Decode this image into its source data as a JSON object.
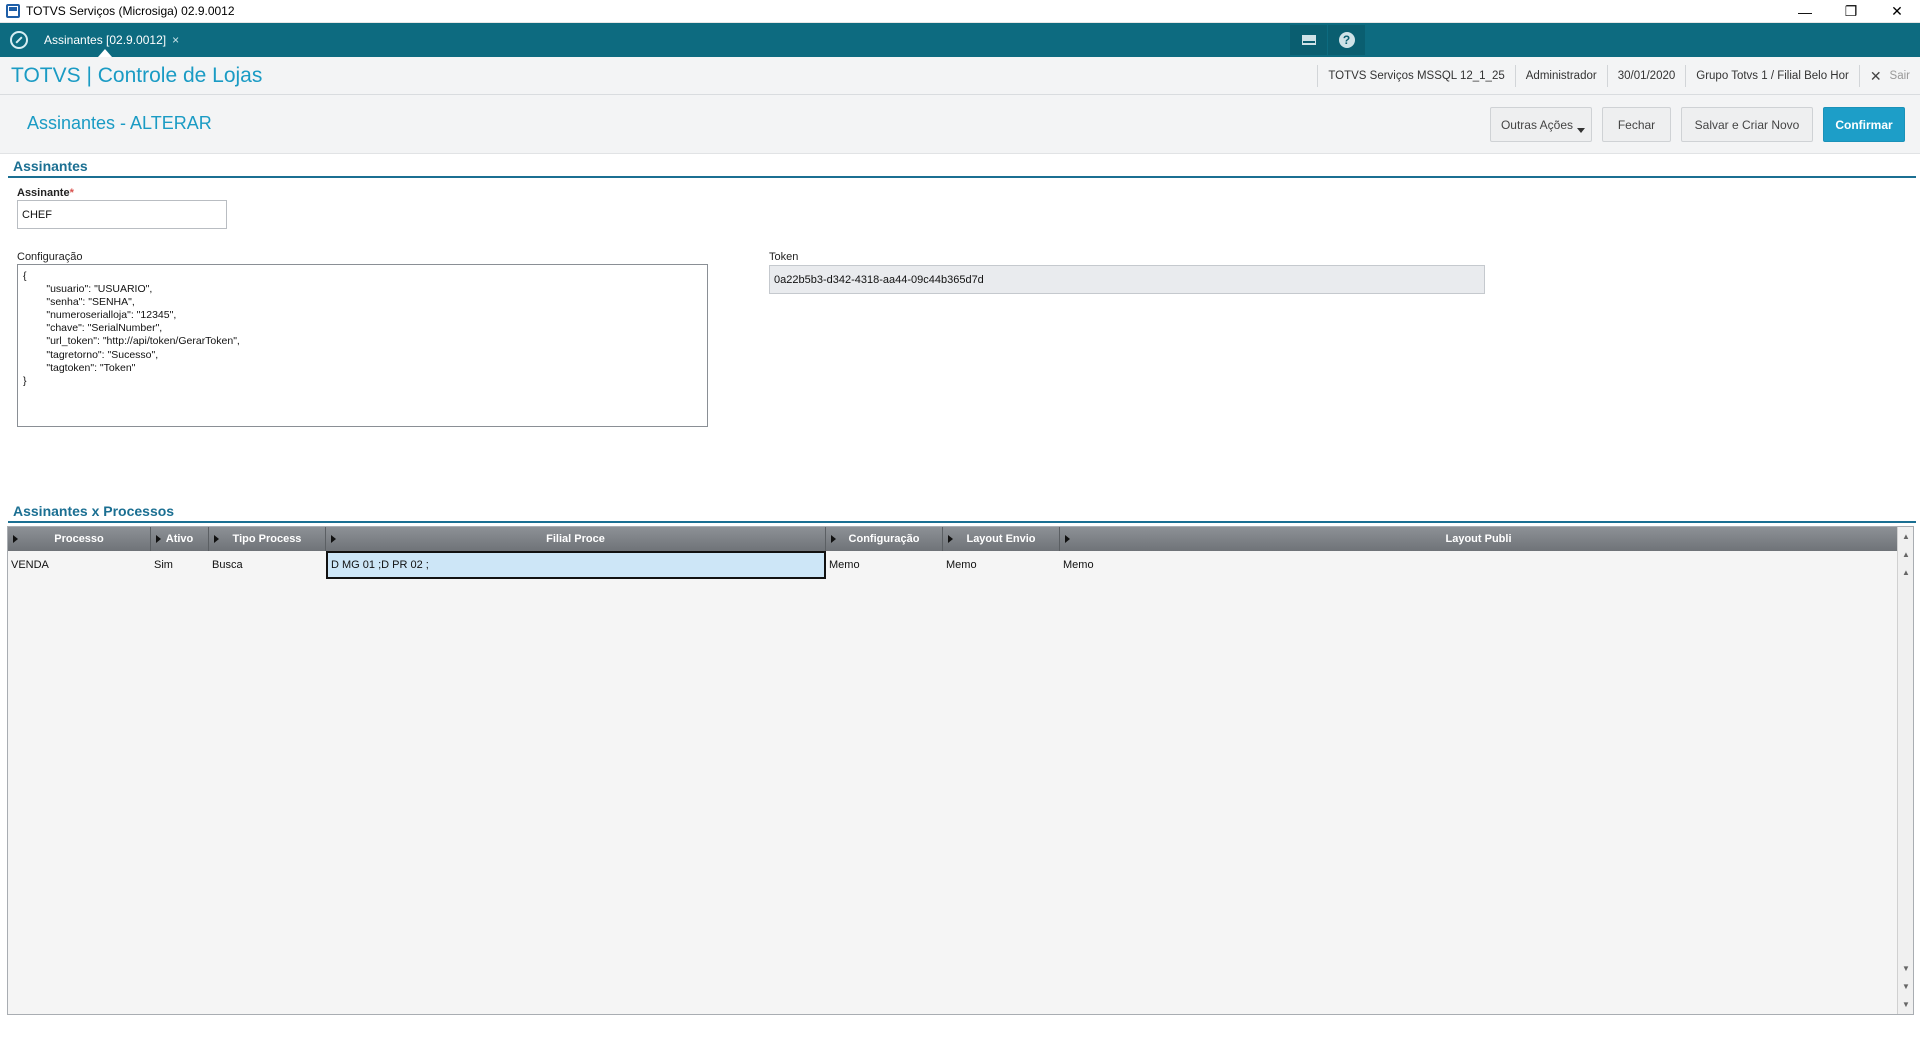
{
  "window": {
    "title": "TOTVS Serviços (Microsiga) 02.9.0012",
    "minimize": "—",
    "restore": "❐",
    "close": "✕"
  },
  "tabbar": {
    "active_tab": "Assinantes [02.9.0012]",
    "tab_close": "×",
    "help": "?"
  },
  "header": {
    "brand": "TOTVS | Controle de Lojas",
    "environment": "TOTVS Serviços MSSQL 12_1_25",
    "user": "Administrador",
    "date": "30/01/2020",
    "company": "Grupo Totvs 1 / Filial Belo Hor",
    "exit_label": "Sair",
    "exit_icon": "✕"
  },
  "page": {
    "title": "Assinantes - ALTERAR",
    "buttons": {
      "other_actions": "Outras Ações",
      "close": "Fechar",
      "save_new": "Salvar e Criar Novo",
      "confirm": "Confirmar"
    }
  },
  "form": {
    "section_title": "Assinantes",
    "assinante_label": "Assinante",
    "required_mark": "*",
    "assinante_value": "CHEF",
    "config_label": "Configuração",
    "config_value": "{\n        \"usuario\": \"USUARIO\",\n        \"senha\": \"SENHA\",\n        \"numeroserialloja\": \"12345\",\n        \"chave\": \"SerialNumber\",\n        \"url_token\": \"http://api/token/GerarToken\",\n        \"tagretorno\": \"Sucesso\",\n        \"tagtoken\": \"Token\"\n}",
    "token_label": "Token",
    "token_value": "0a22b5b3-d342-4318-aa44-09c44b365d7d"
  },
  "processes": {
    "section_title": "Assinantes x Processos",
    "columns": [
      "Processo",
      "Ativo",
      "Tipo Process",
      "Filial Proce",
      "Configuração",
      "Layout Envio",
      "Layout Publi"
    ],
    "rows": [
      [
        "VENDA",
        "Sim",
        "Busca",
        "D MG 01 ;D PR 02 ;",
        "Memo",
        "Memo",
        "Memo"
      ]
    ]
  },
  "colors": {
    "teal_bar": "#0d6b80",
    "brand_blue": "#1a9bc4",
    "section_blue": "#1b6f92",
    "primary_button": "#1d9ec8",
    "selected_cell": "#cde6f7"
  }
}
